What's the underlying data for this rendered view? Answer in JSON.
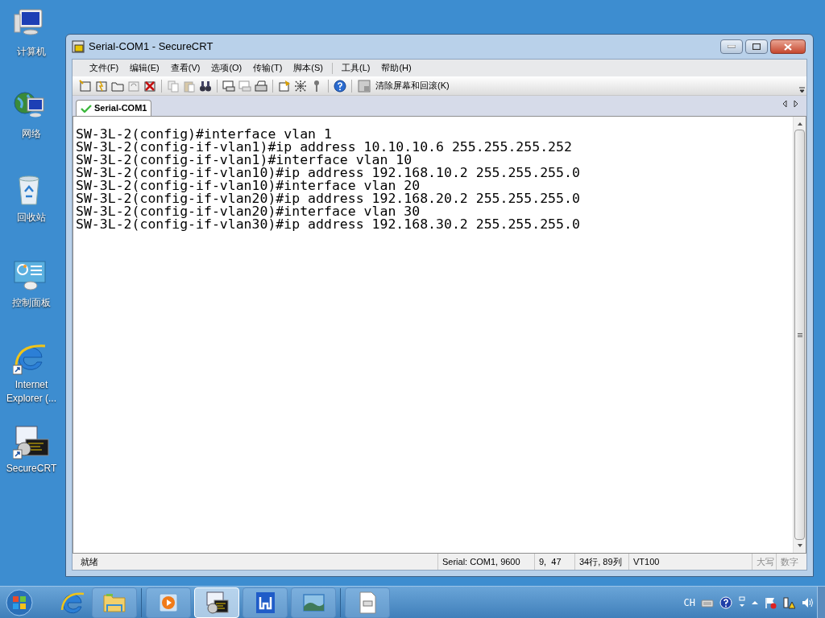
{
  "desktop_icons": [
    {
      "kind": "computer",
      "label": "计算机"
    },
    {
      "kind": "network",
      "label": "网络"
    },
    {
      "kind": "recycle",
      "label": "回收站"
    },
    {
      "kind": "control",
      "label": "控制面板"
    },
    {
      "kind": "ie",
      "label": "Internet Explorer (..."
    },
    {
      "kind": "securecrt",
      "label": "SecureCRT"
    }
  ],
  "window": {
    "title": "Serial-COM1 - SecureCRT",
    "menu": [
      "文件(F)",
      "编辑(E)",
      "查看(V)",
      "选项(O)",
      "传输(T)",
      "脚本(S)",
      "工具(L)",
      "帮助(H)"
    ],
    "toolbar_button": "清除屏幕和回滚(K)",
    "tabs": [
      {
        "label": "Serial-COM1",
        "selected": true
      }
    ],
    "terminal_lines": [
      "SW-3L-2(config)#interface vlan 1",
      "SW-3L-2(config-if-vlan1)#ip address 10.10.10.6 255.255.255.252",
      "SW-3L-2(config-if-vlan1)#interface vlan 10",
      "SW-3L-2(config-if-vlan10)#ip address 192.168.10.2 255.255.255.0",
      "SW-3L-2(config-if-vlan10)#interface vlan 20",
      "SW-3L-2(config-if-vlan20)#ip address 192.168.20.2 255.255.255.0",
      "SW-3L-2(config-if-vlan20)#interface vlan 30",
      "SW-3L-2(config-if-vlan30)#ip address 192.168.30.2 255.255.255.0"
    ],
    "status_bar": {
      "message": "就绪",
      "panes": [
        {
          "text": "Serial: COM1, 9600",
          "disabled": false
        },
        {
          "text": "9,  47",
          "disabled": false
        },
        {
          "text": "34行, 89列",
          "disabled": false
        },
        {
          "text": "VT100",
          "disabled": false
        },
        {
          "text": "大写",
          "disabled": true
        },
        {
          "text": "数字",
          "disabled": true
        }
      ]
    }
  },
  "taskbar": {
    "apps": [
      {
        "kind": "explorer",
        "active": false
      },
      {
        "kind": "media",
        "active": false
      },
      {
        "kind": "securecrt",
        "active": true
      },
      {
        "kind": "wps",
        "active": false
      },
      {
        "kind": "photo",
        "active": false
      },
      {
        "kind": "document",
        "active": false
      }
    ],
    "language": "CH"
  }
}
